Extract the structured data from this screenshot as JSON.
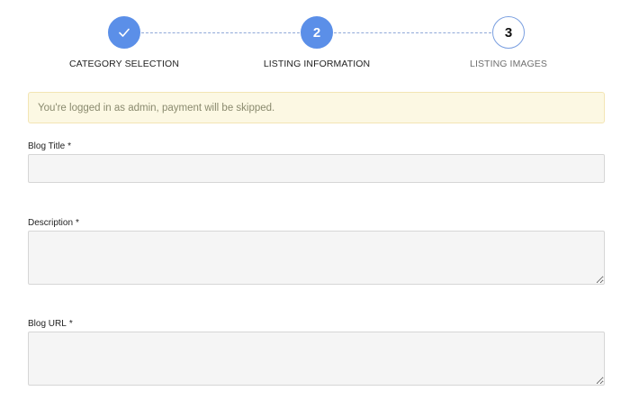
{
  "stepper": {
    "steps": [
      {
        "number": "",
        "label": "CATEGORY SELECTION",
        "state": "done",
        "icon": "check-icon"
      },
      {
        "number": "2",
        "label": "LISTING INFORMATION",
        "state": "active"
      },
      {
        "number": "3",
        "label": "LISTING IMAGES",
        "state": "pending"
      }
    ],
    "colors": {
      "accent": "#5b8fe8",
      "line": "#8fa8d8"
    }
  },
  "alert": {
    "text": "You're logged in as admin, payment will be skipped.",
    "background": "#fcf8e3"
  },
  "form": {
    "required_mark": "*",
    "blog_title": {
      "label": "Blog Title",
      "value": ""
    },
    "description": {
      "label": "Description",
      "value": ""
    },
    "blog_url": {
      "label": "Blog URL",
      "value": ""
    }
  }
}
